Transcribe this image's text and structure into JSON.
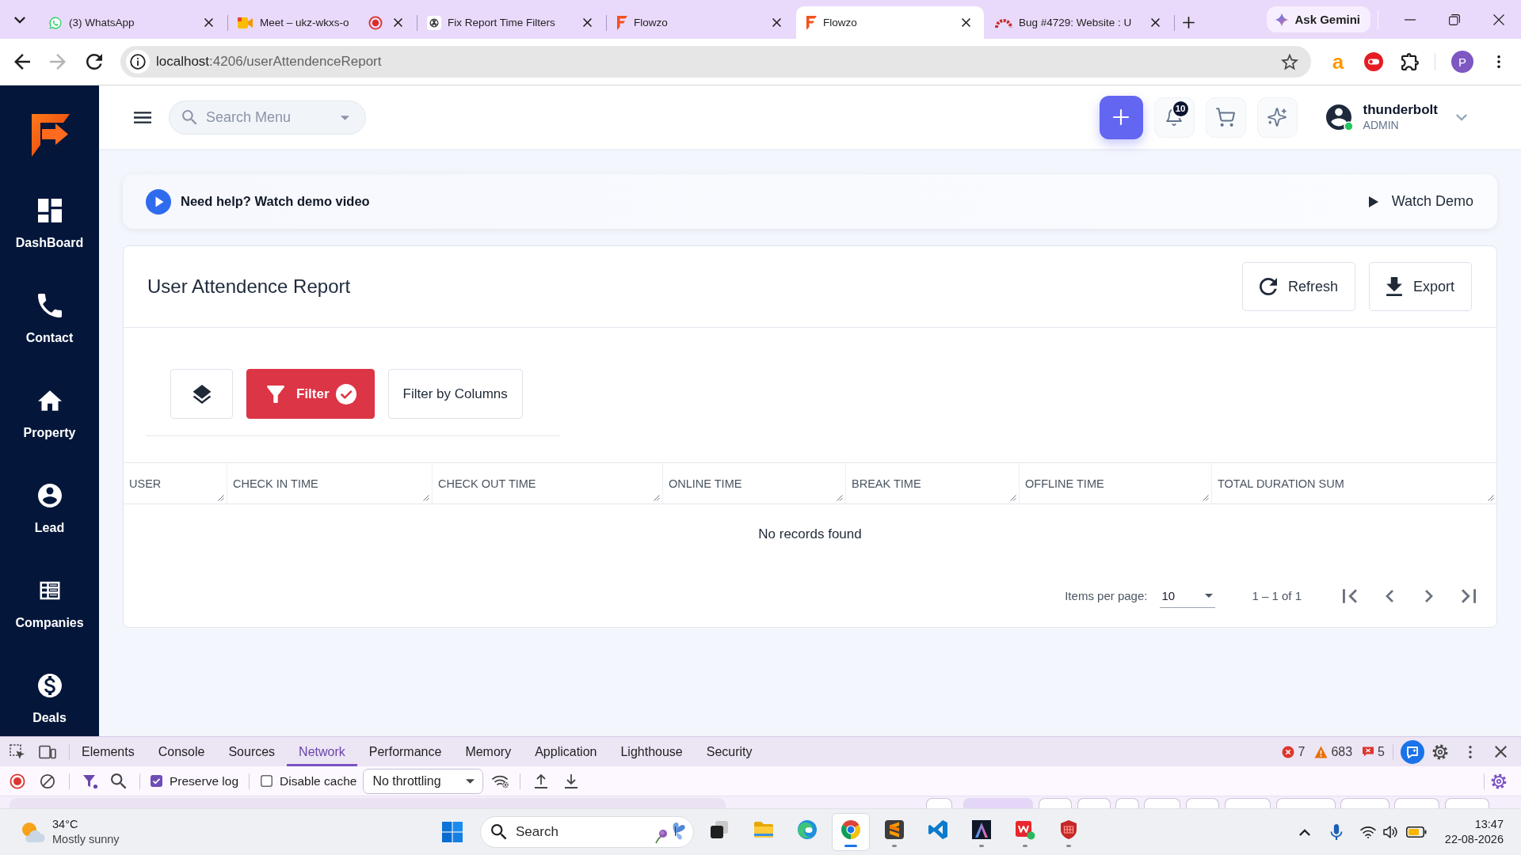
{
  "browser": {
    "tabs": [
      {
        "title": "(3) WhatsApp",
        "kind": "chat",
        "selected": false,
        "recording": false
      },
      {
        "title": "Meet – ukz-wkxs-o",
        "kind": "video",
        "selected": false,
        "recording": true
      },
      {
        "title": "Fix Report Time Filters",
        "kind": "knot",
        "selected": false,
        "recording": false
      },
      {
        "title": "Flowzo",
        "kind": "logo",
        "selected": false,
        "recording": false
      },
      {
        "title": "Flowzo",
        "kind": "logo",
        "selected": true,
        "recording": false
      },
      {
        "title": "Bug #4729: Website : U",
        "kind": "arch",
        "selected": false,
        "recording": false
      }
    ],
    "ask_button": "Ask Gemini",
    "navigation": {
      "back_disabled": false,
      "forward_disabled": true
    },
    "address": {
      "host": "localhost",
      "path": ":4206/userAttendenceReport"
    },
    "extension_letter": "a",
    "profile_initial": "P"
  },
  "sidebar": {
    "items": [
      {
        "label": "DashBoard",
        "kind": "dashboard",
        "selected": false
      },
      {
        "label": "Contact",
        "kind": "phone",
        "selected": false
      },
      {
        "label": "Property",
        "kind": "home",
        "selected": false
      },
      {
        "label": "Lead",
        "kind": "person",
        "selected": false
      },
      {
        "label": "Companies",
        "kind": "table",
        "selected": false
      },
      {
        "label": "Deals",
        "kind": "coin",
        "selected": false
      }
    ]
  },
  "header": {
    "search": {
      "placeholder": "Search Menu"
    },
    "notification_count": "10",
    "user": {
      "name": "thunderbolt",
      "role": "ADMIN",
      "online": true
    }
  },
  "help_banner": {
    "text": "Need help? Watch demo video",
    "action": "Watch Demo"
  },
  "report": {
    "title": "User Attendence Report",
    "actions": [
      {
        "label": "Refresh",
        "kind": "refresh"
      },
      {
        "label": "Export",
        "kind": "export"
      }
    ],
    "filter": {
      "label": "Filter",
      "active": true
    },
    "column_filter": "Filter by Columns",
    "table": {
      "columns": [
        "USER",
        "CHECK IN TIME",
        "CHECK OUT TIME",
        "ONLINE TIME",
        "BREAK TIME",
        "OFFLINE TIME",
        "TOTAL DURATION SUM"
      ],
      "empty_message": "No records found"
    },
    "paginator": {
      "label": "Items per page:",
      "page_size": "10",
      "range": "1 – 1 of 1"
    }
  },
  "devtools": {
    "tabs": [
      {
        "label": "Elements",
        "selected": false
      },
      {
        "label": "Console",
        "selected": false
      },
      {
        "label": "Sources",
        "selected": false
      },
      {
        "label": "Network",
        "selected": true
      },
      {
        "label": "Performance",
        "selected": false
      },
      {
        "label": "Memory",
        "selected": false
      },
      {
        "label": "Application",
        "selected": false
      },
      {
        "label": "Lighthouse",
        "selected": false
      },
      {
        "label": "Security",
        "selected": false
      }
    ],
    "counts": {
      "errors": "7",
      "warnings": "683",
      "issues": "5"
    },
    "recording": true,
    "preserve_log": {
      "label": "Preserve log",
      "checked": true
    },
    "disable_cache": {
      "label": "Disable cache",
      "checked": false
    },
    "throttling": "No throttling",
    "type_filters": [
      {
        "selected": false
      },
      {
        "selected": true
      },
      {
        "selected": false
      },
      {
        "selected": false
      },
      {
        "selected": false
      },
      {
        "selected": false
      },
      {
        "selected": false
      },
      {
        "selected": false
      },
      {
        "selected": false
      },
      {
        "selected": false
      },
      {
        "selected": false
      },
      {
        "selected": false
      }
    ]
  },
  "taskbar": {
    "weather": {
      "temperature": "34°C",
      "condition": "Mostly sunny"
    },
    "search": {
      "placeholder": "Search"
    },
    "apps": [
      {
        "kind": "taskview",
        "running": false,
        "focused": false
      },
      {
        "kind": "folder",
        "running": false,
        "focused": false
      },
      {
        "kind": "swirl",
        "running": false,
        "focused": false
      },
      {
        "kind": "ring",
        "running": true,
        "focused": true
      },
      {
        "kind": "editor",
        "running": true,
        "focused": false
      },
      {
        "kind": "ribbon",
        "running": false,
        "focused": false
      },
      {
        "kind": "peak",
        "running": true,
        "focused": false
      },
      {
        "kind": "office",
        "running": true,
        "focused": false
      },
      {
        "kind": "shield",
        "running": true,
        "focused": false
      }
    ],
    "clock": {
      "time": "13:47",
      "date": "22-08-2026"
    }
  }
}
